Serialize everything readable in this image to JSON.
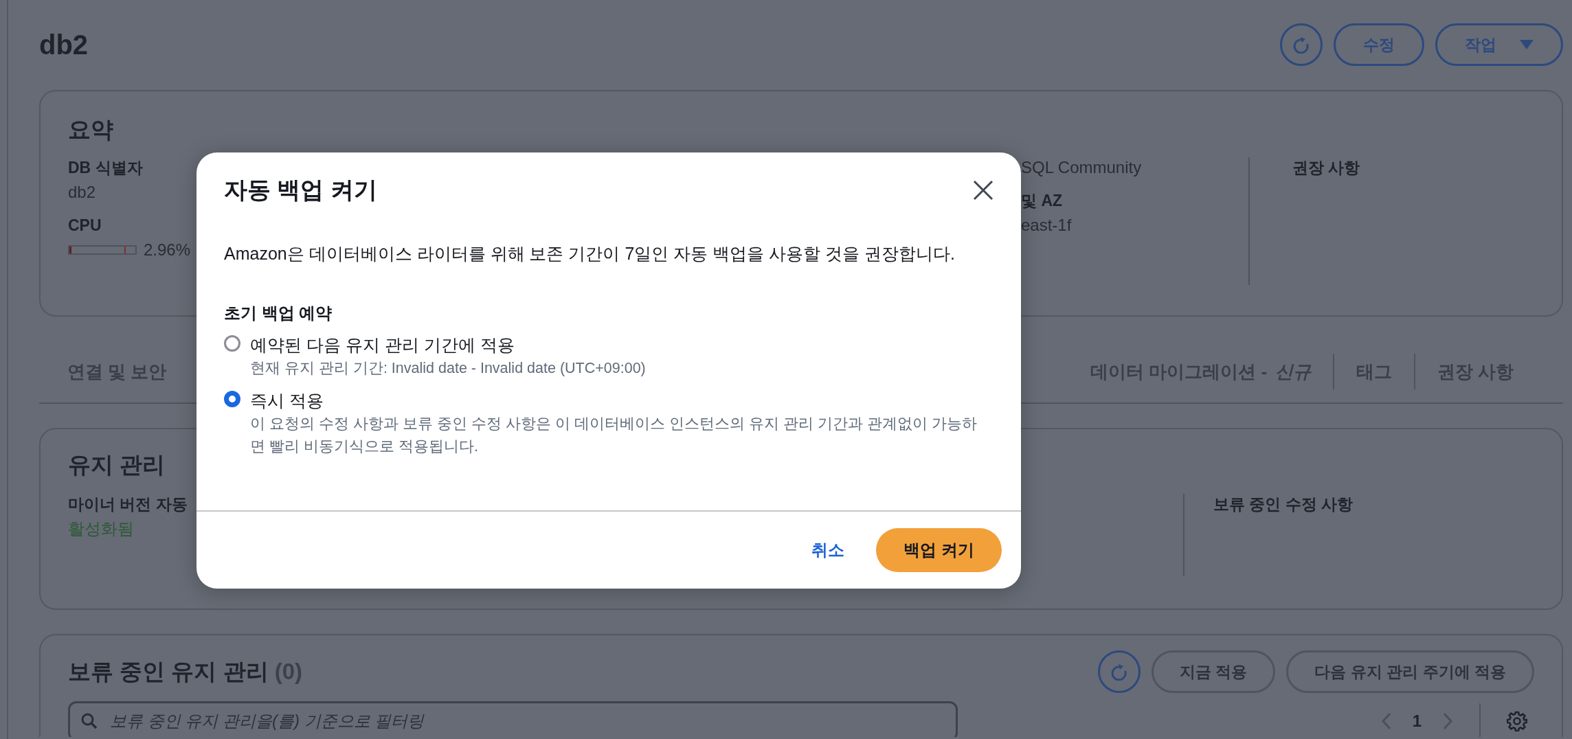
{
  "page": {
    "title": "db2",
    "actions": [
      {
        "kind": "refresh"
      },
      {
        "kind": "button",
        "label": "수정"
      },
      {
        "kind": "dropdown",
        "label": "작업"
      }
    ]
  },
  "summary": {
    "title": "요약",
    "columns": [
      {
        "fields": [
          {
            "label": "DB 식별자",
            "value": "db2"
          },
          {
            "label": "CPU",
            "kind": "meter",
            "level": 0.03,
            "value": "2.96%"
          }
        ]
      },
      {
        "fields": [
          {
            "value": "SQL Community"
          },
          {
            "label": "및 AZ",
            "value": "east-1f"
          }
        ]
      },
      {
        "fields": [
          {
            "label": "권장 사항"
          }
        ]
      }
    ]
  },
  "tabs": [
    {
      "label": "연결 및 보안",
      "selected": false
    },
    {
      "label": "데이터 마이그레이션 - *신규*",
      "selected": false
    },
    {
      "label": "태그",
      "selected": false
    },
    {
      "label": "권장 사항",
      "selected": false
    }
  ],
  "maintenance": {
    "title": "유지 관리",
    "columns": [
      {
        "label": "마이너 버전 자동",
        "value": "활성화됨"
      },
      {
        "label": "보류 중인 수정 사항"
      }
    ]
  },
  "pending": {
    "title": "보류 중인 유지 관리",
    "count": "(0)",
    "buttons": [
      {
        "label": "지금 적용",
        "disabled": true
      },
      {
        "label": "다음 유지 관리 주기에 적용",
        "disabled": true
      }
    ],
    "search": {
      "placeholder": "보류 중인 유지 관리을(를) 기준으로 필터링"
    },
    "pagination": {
      "page": "1"
    }
  },
  "modal": {
    "title": "자동 백업 켜기",
    "message": "Amazon은 데이터베이스 라이터를 위해 보존 기간이 7일인 자동 백업을 사용할 것을 권장합니다.",
    "group_label": "초기 백업 예약",
    "options": [
      {
        "label": "예약된 다음 유지 관리 기간에 적용",
        "description": "현재 유지 관리 기간: Invalid date - Invalid date (UTC+09:00)",
        "selected": false
      },
      {
        "label": "즉시 적용",
        "description": "이 요청의 수정 사항과 보류 중인 수정 사항은 이 데이터베이스 인스턴스의 유지 관리 기간과 관계없이 가능하면 빨리 비동기식으로 적용됩니다.",
        "selected": true
      }
    ],
    "cancel": "취소",
    "confirm": "백업 켜기"
  }
}
